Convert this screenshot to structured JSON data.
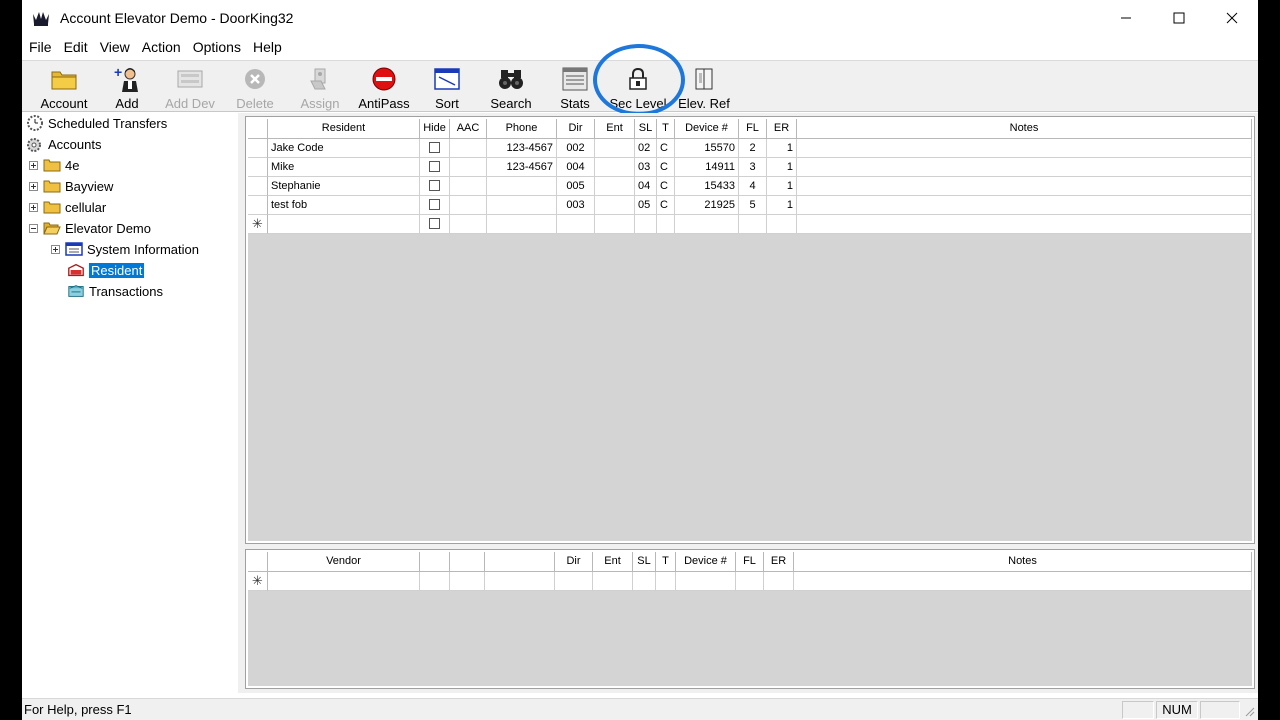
{
  "window": {
    "title": "Account Elevator Demo - DoorKing32"
  },
  "menu": [
    "File",
    "Edit",
    "View",
    "Action",
    "Options",
    "Help"
  ],
  "toolbar": [
    {
      "label": "Account",
      "icon": "folder-icon",
      "enabled": true
    },
    {
      "label": "Add",
      "icon": "add-person-icon",
      "enabled": true
    },
    {
      "label": "Add Dev",
      "icon": "keypad-icon",
      "enabled": false
    },
    {
      "label": "Delete",
      "icon": "delete-icon",
      "enabled": false
    },
    {
      "label": "Assign",
      "icon": "assign-icon",
      "enabled": false
    },
    {
      "label": "AntiPass",
      "icon": "no-entry-icon",
      "enabled": true
    },
    {
      "label": "Sort",
      "icon": "sort-icon",
      "enabled": true
    },
    {
      "label": "Search",
      "icon": "binoculars-icon",
      "enabled": true
    },
    {
      "label": "Stats",
      "icon": "stats-icon",
      "enabled": true
    },
    {
      "label": "Sec Level",
      "icon": "padlock-icon",
      "enabled": true
    },
    {
      "label": "Elev. Ref",
      "icon": "elevator-icon",
      "enabled": true
    }
  ],
  "tree": {
    "scheduled": "Scheduled Transfers",
    "accounts": "Accounts",
    "items": [
      "4e",
      "Bayview",
      "cellular",
      "Elevator Demo"
    ],
    "children": [
      "System Information",
      "Resident",
      "Transactions"
    ]
  },
  "resident_grid": {
    "headers": [
      "Resident",
      "Hide",
      "AAC",
      "Phone",
      "Dir",
      "Ent",
      "SL",
      "T",
      "Device #",
      "FL",
      "ER",
      "Notes"
    ],
    "rows": [
      {
        "name": "Jake Code",
        "phone": "123-4567",
        "dir": "002",
        "ent": "",
        "sl": "02",
        "t": "C",
        "device": "15570",
        "fl": "2",
        "er": "1"
      },
      {
        "name": "Mike",
        "phone": "123-4567",
        "dir": "004",
        "ent": "",
        "sl": "03",
        "t": "C",
        "device": "14911",
        "fl": "3",
        "er": "1"
      },
      {
        "name": "Stephanie",
        "phone": "",
        "dir": "005",
        "ent": "",
        "sl": "04",
        "t": "C",
        "device": "15433",
        "fl": "4",
        "er": "1"
      },
      {
        "name": "test fob",
        "phone": "",
        "dir": "003",
        "ent": "",
        "sl": "05",
        "t": "C",
        "device": "21925",
        "fl": "5",
        "er": "1"
      }
    ],
    "new_row_marker": "✳"
  },
  "vendor_grid": {
    "headers": [
      "Vendor",
      "",
      "",
      "",
      "Dir",
      "Ent",
      "SL",
      "T",
      "Device #",
      "FL",
      "ER",
      "Notes"
    ],
    "new_row_marker": "✳"
  },
  "status": {
    "help": "For Help, press F1",
    "num": "NUM"
  }
}
